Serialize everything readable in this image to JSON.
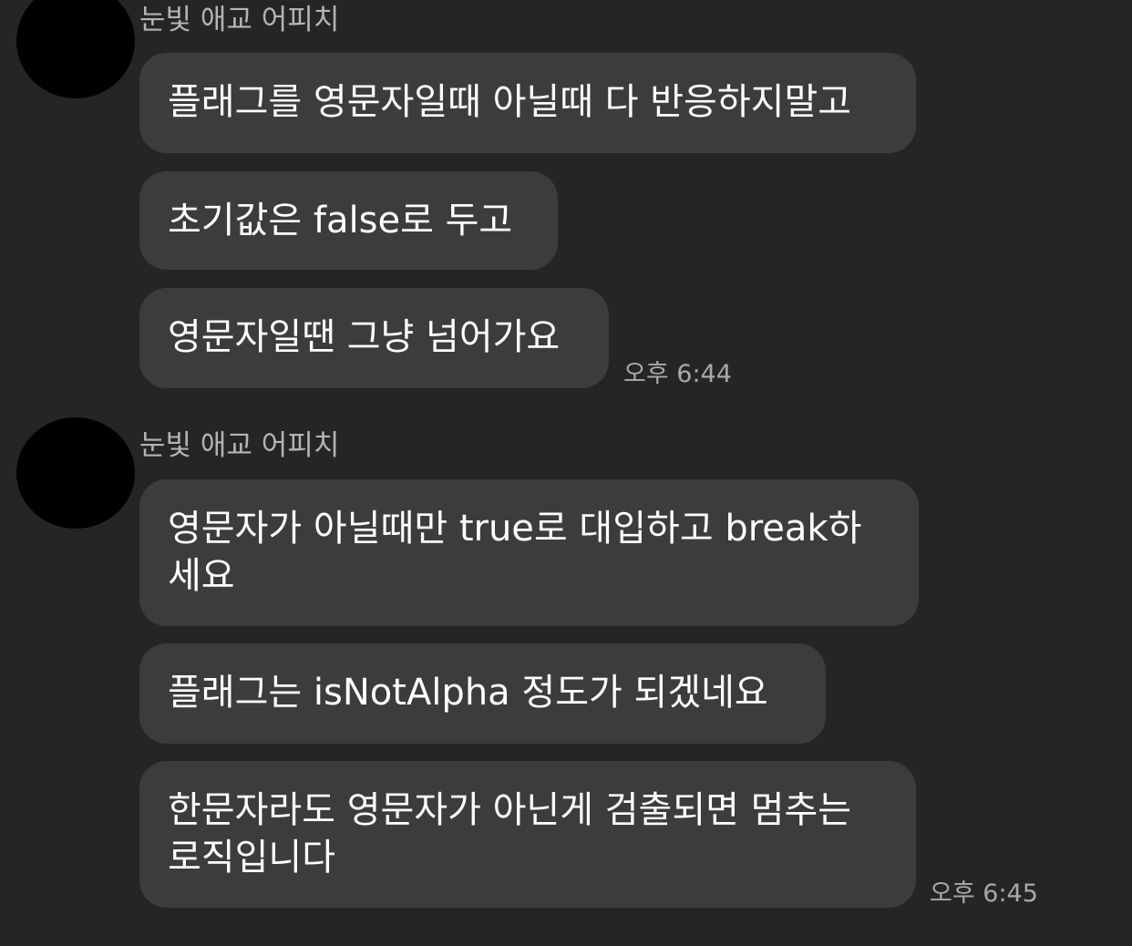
{
  "chat": {
    "groups": [
      {
        "sender": "눈빛 애교 어피치",
        "messages": [
          "플래그를 영문자일때 아닐때 다 반응하지말고",
          "초기값은 false로 두고",
          "영문자일땐 그냥 넘어가요"
        ],
        "time": "오후 6:44"
      },
      {
        "sender": "눈빛 애교 어피치",
        "messages": [
          "영문자가 아닐때만 true로 대입하고 break하세요",
          "플래그는 isNotAlpha 정도가 되겠네요",
          "한문자라도 영문자가 아닌게 검출되면 멈추는 로직입니다"
        ],
        "time": "오후 6:45"
      }
    ]
  },
  "colors": {
    "background": "#252527",
    "bubble": "#3c3c3f",
    "message_text": "#ffffff",
    "sender_text": "#b4b4b6",
    "time_text": "#a9a9ab",
    "avatar": "#000000"
  }
}
